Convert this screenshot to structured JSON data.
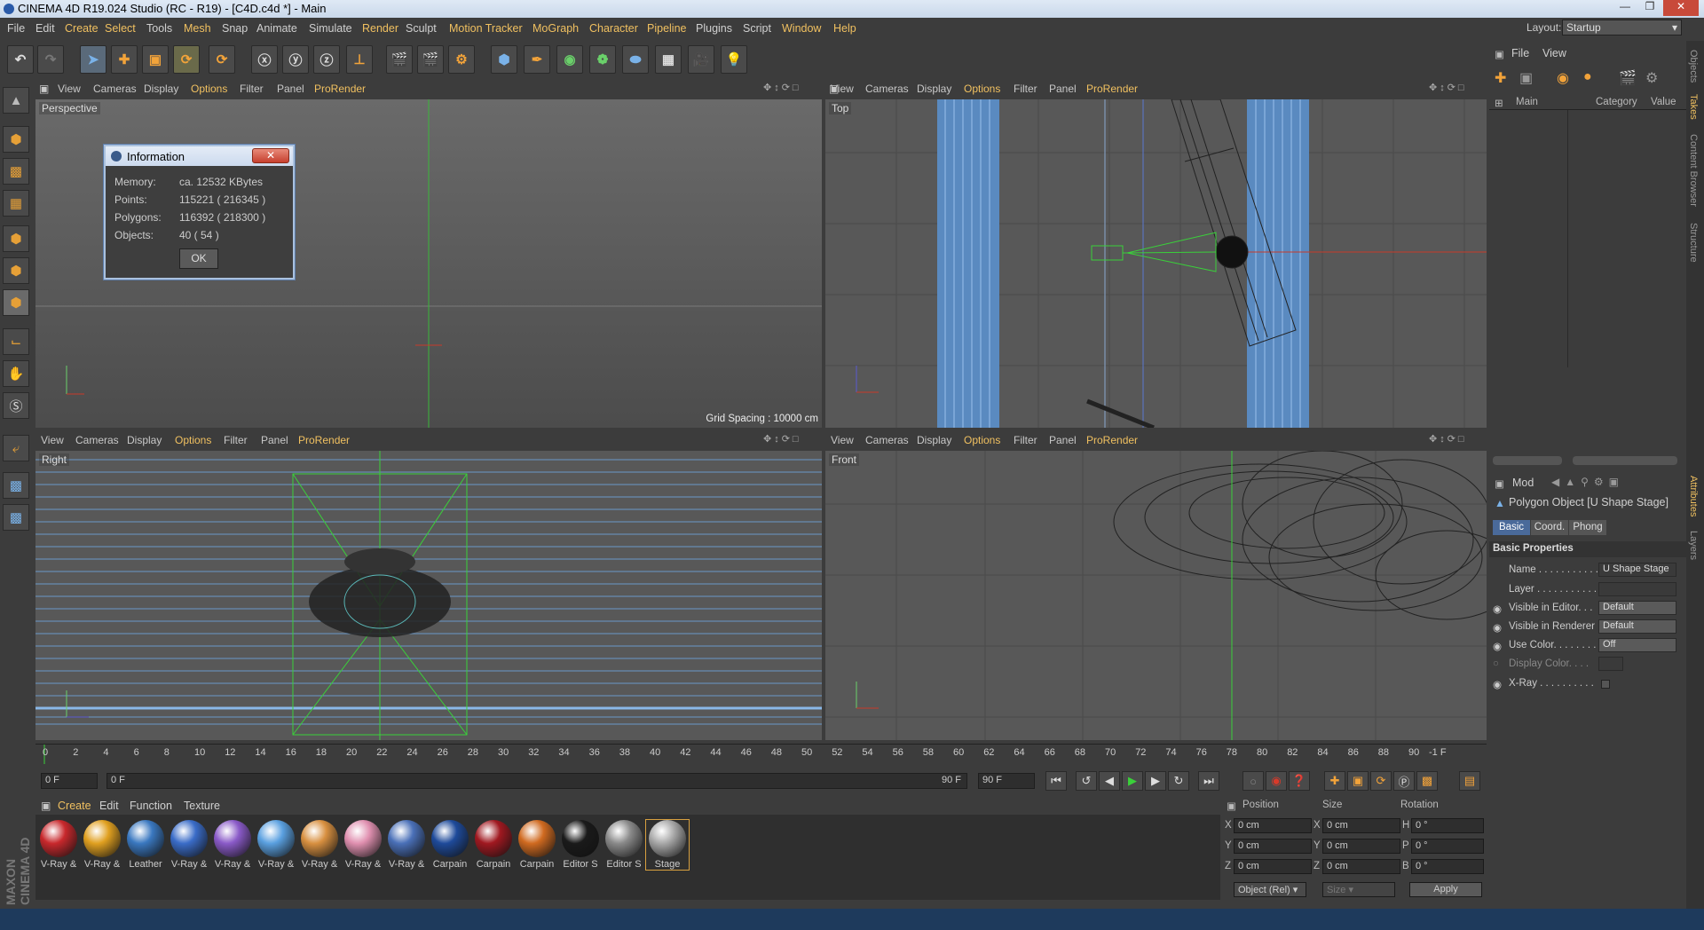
{
  "window": {
    "title": "CINEMA 4D R19.024 Studio (RC - R19) - [C4D.c4d *] - Main"
  },
  "menu": [
    "File",
    "Edit",
    "Create",
    "Select",
    "Tools",
    "Mesh",
    "Snap",
    "Animate",
    "Simulate",
    "Render",
    "Sculpt",
    "Motion Tracker",
    "MoGraph",
    "Character",
    "Pipeline",
    "Plugins",
    "Script",
    "Window",
    "Help"
  ],
  "layout": {
    "label": "Layout:",
    "value": "Startup"
  },
  "viewport_menu": [
    "View",
    "Cameras",
    "Display",
    "Options",
    "Filter",
    "Panel",
    "ProRender"
  ],
  "viewports": {
    "perspective": "Perspective",
    "top": "Top",
    "right": "Right",
    "front": "Front",
    "grid_spacing": "Grid Spacing : 10000 cm"
  },
  "info_dialog": {
    "title": "Information",
    "rows": [
      {
        "label": "Memory:",
        "value": "ca. 12532 KBytes"
      },
      {
        "label": "Points:",
        "value": "115221 ( 216345 )"
      },
      {
        "label": "Polygons:",
        "value": "116392 ( 218300 )"
      },
      {
        "label": "Objects:",
        "value": "40 ( 54 )"
      }
    ],
    "ok": "OK"
  },
  "timeline": {
    "ticks": [
      "0",
      "2",
      "4",
      "6",
      "8",
      "10",
      "12",
      "14",
      "16",
      "18",
      "20",
      "22",
      "24",
      "26",
      "28",
      "30",
      "32",
      "34",
      "36",
      "38",
      "40",
      "42",
      "44",
      "46",
      "48",
      "50",
      "52",
      "54",
      "56",
      "58",
      "60",
      "62",
      "64",
      "66",
      "68",
      "70",
      "72",
      "74",
      "76",
      "78",
      "80",
      "82",
      "84",
      "86",
      "88",
      "90"
    ],
    "end": "-1 F",
    "start_field": "0 F",
    "range_start": "0 F",
    "range_end": "90 F",
    "end_field": "90 F"
  },
  "materials": {
    "tabs": [
      "Create",
      "Edit",
      "Function",
      "Texture"
    ],
    "items": [
      {
        "label": "V-Ray &",
        "color": "#c8282c"
      },
      {
        "label": "V-Ray &",
        "color": "#e0a020"
      },
      {
        "label": "Leather",
        "color": "#3a78c0"
      },
      {
        "label": "V-Ray &",
        "color": "#3a6cc8"
      },
      {
        "label": "V-Ray &",
        "color": "#8a5ac8"
      },
      {
        "label": "V-Ray &",
        "color": "#5aa0e0"
      },
      {
        "label": "V-Ray &",
        "color": "#d89040"
      },
      {
        "label": "V-Ray &",
        "color": "#e090b0"
      },
      {
        "label": "V-Ray &",
        "color": "#4a70b8"
      },
      {
        "label": "Carpain",
        "color": "#1e4a9a"
      },
      {
        "label": "Carpain",
        "color": "#a01820"
      },
      {
        "label": "Carpain",
        "color": "#d06a20"
      },
      {
        "label": "Editor S",
        "color": "#1a1a1a"
      },
      {
        "label": "Editor S",
        "color": "#8a8a8a"
      },
      {
        "label": "Stage",
        "color": "#a8a8a8"
      }
    ]
  },
  "coords": {
    "headers": [
      "Position",
      "Size",
      "Rotation"
    ],
    "rows": [
      {
        "a": "X",
        "pos": "0 cm",
        "b": "X",
        "size": "0 cm",
        "c": "H",
        "rot": "0 °"
      },
      {
        "a": "Y",
        "pos": "0 cm",
        "b": "Y",
        "size": "0 cm",
        "c": "P",
        "rot": "0 °"
      },
      {
        "a": "Z",
        "pos": "0 cm",
        "b": "Z",
        "size": "0 cm",
        "c": "B",
        "rot": "0 °"
      }
    ],
    "mode": "Object (Rel)",
    "size_mode": "Size",
    "apply": "Apply"
  },
  "objects_panel": {
    "menu": [
      "File",
      "View"
    ],
    "cols": [
      "Main",
      "Category",
      "Value"
    ]
  },
  "attributes": {
    "mode": "Mod",
    "object": "Polygon Object [U Shape Stage]",
    "tabs": [
      "Basic",
      "Coord.",
      "Phong"
    ],
    "section": "Basic Properties",
    "rows": [
      {
        "label": "Name . . . . . . . . . . .",
        "value": "U Shape Stage"
      },
      {
        "label": "Layer . . . . . . . . . . .",
        "value": ""
      },
      {
        "label": "Visible in Editor. . .",
        "value": "Default"
      },
      {
        "label": "Visible in Renderer",
        "value": "Default"
      },
      {
        "label": "Use Color. . . . . . . .",
        "value": "Off"
      },
      {
        "label": "Display Color. . . .",
        "value": ""
      },
      {
        "label": "X-Ray . . . . . . . . . .",
        "value": ""
      }
    ]
  },
  "side_tabs": [
    "Objects",
    "Takes",
    "Content Browser",
    "Structure",
    "Attributes",
    "Layers"
  ],
  "brand": "MAXON CINEMA 4D"
}
